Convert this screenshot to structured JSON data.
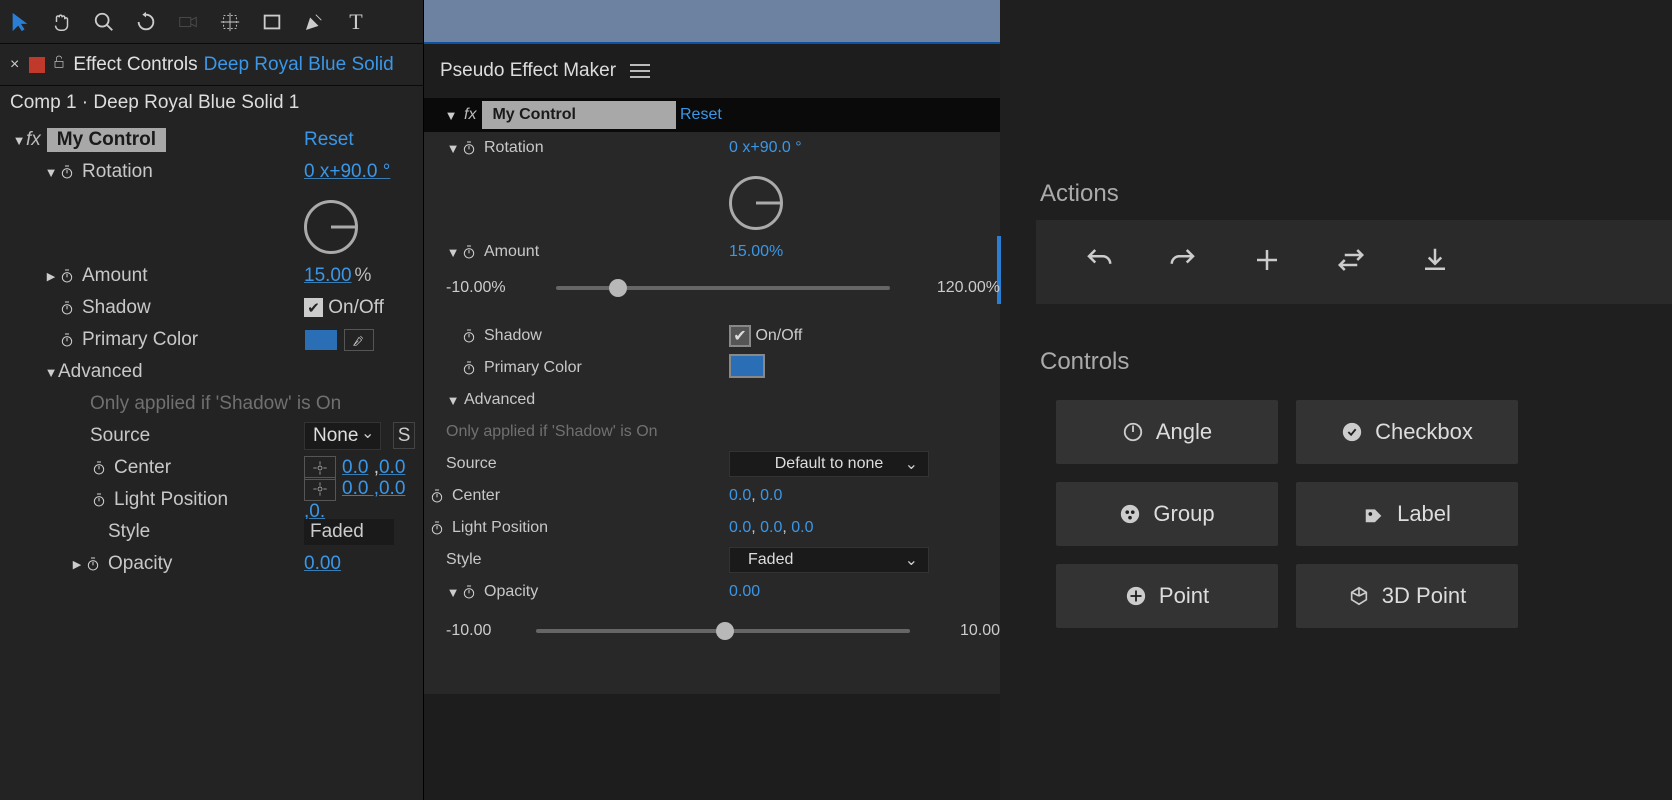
{
  "left": {
    "tab": {
      "title": "Effect Controls",
      "layer": "Deep Royal Blue Solid"
    },
    "breadcrumb": "Comp 1 · Deep Royal Blue Solid 1",
    "effect_name": "My Control",
    "reset": "Reset",
    "rotation": {
      "label": "Rotation",
      "value": "0 x+90.0 °"
    },
    "amount": {
      "label": "Amount",
      "value": "15.00",
      "unit": "%"
    },
    "shadow": {
      "label": "Shadow",
      "onoff": "On/Off"
    },
    "primary": {
      "label": "Primary Color"
    },
    "advanced": {
      "label": "Advanced",
      "hint": "Only applied if 'Shadow' is On"
    },
    "source": {
      "label": "Source",
      "value": "None"
    },
    "center": {
      "label": "Center",
      "x": "0.0",
      "y": "0.0"
    },
    "lightpos": {
      "label": "Light Position",
      "value": "0.0 ,0.0 ,0."
    },
    "style": {
      "label": "Style",
      "value": "Faded"
    },
    "opacity": {
      "label": "Opacity",
      "value": "0.00"
    }
  },
  "middle": {
    "title": "Pseudo Effect Maker",
    "effect_name": "My Control",
    "reset": "Reset",
    "rotation": {
      "label": "Rotation",
      "value": "0 x+90.0 °"
    },
    "amount": {
      "label": "Amount",
      "value": "15.00%",
      "min": "-10.00%",
      "max": "120.00%"
    },
    "shadow": {
      "label": "Shadow",
      "onoff": "On/Off"
    },
    "primary": {
      "label": "Primary Color"
    },
    "advanced": {
      "label": "Advanced",
      "hint": "Only applied if 'Shadow' is On"
    },
    "source": {
      "label": "Source",
      "value": "Default to none"
    },
    "center": {
      "label": "Center",
      "x": "0.0",
      "y": "0.0"
    },
    "lightpos": {
      "label": "Light Position",
      "x": "0.0",
      "y": "0.0",
      "z": "0.0"
    },
    "style": {
      "label": "Style",
      "value": "Faded"
    },
    "opacity": {
      "label": "Opacity",
      "value": "0.00",
      "min": "-10.00",
      "max": "10.00"
    }
  },
  "right": {
    "actions_title": "Actions",
    "controls_title": "Controls",
    "controls": {
      "angle": "Angle",
      "checkbox": "Checkbox",
      "group": "Group",
      "label": "Label",
      "point": "Point",
      "point3d": "3D Point"
    }
  }
}
